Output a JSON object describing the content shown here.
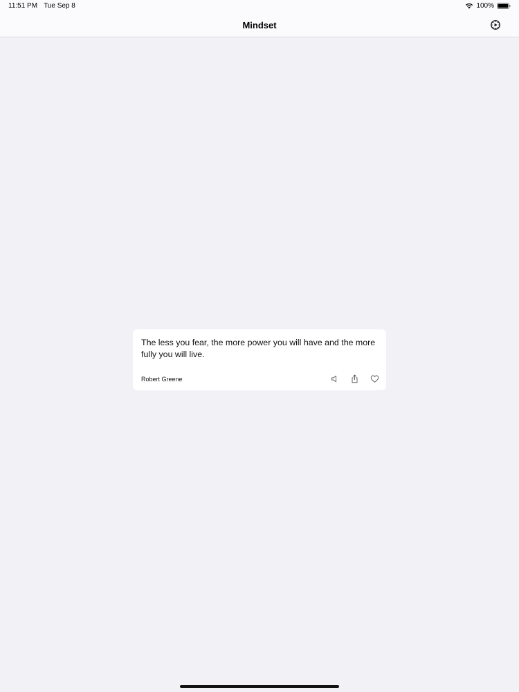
{
  "status_bar": {
    "time": "11:51 PM",
    "date": "Tue Sep 8",
    "battery": "100%"
  },
  "nav": {
    "title": "Mindset",
    "settings_icon": "settings-icon"
  },
  "quote": {
    "text": "The less you fear, the more power you will have and the more fully you will live.",
    "author": "Robert Greene",
    "actions": [
      "speaker-icon",
      "share-icon",
      "heart-icon"
    ]
  },
  "colors": {
    "background": "#f2f1f5",
    "card": "#ffffff",
    "nav": "#fbfafd"
  }
}
